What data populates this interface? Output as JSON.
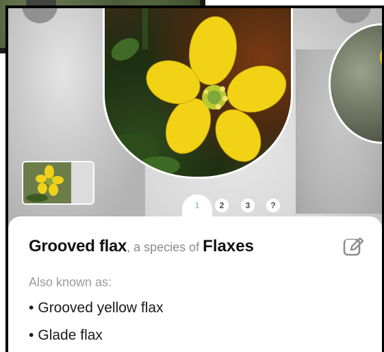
{
  "pager": {
    "pages": [
      "1",
      "2",
      "3",
      "?"
    ],
    "active_index": 0,
    "active_color": "#5fb4c2"
  },
  "result": {
    "common_name": "Grooved flax",
    "connector": ", a species of ",
    "genus_name": "Flaxes",
    "also_known_as_label": "Also known as:",
    "other_names": [
      "Grooved yellow flax",
      "Glade flax"
    ],
    "bullet": "•"
  },
  "icons": {
    "edit": "edit-icon"
  },
  "colors": {
    "card_bg": "#ffffff",
    "muted_text": "#8a8a8a",
    "flower": "#f2d215"
  }
}
